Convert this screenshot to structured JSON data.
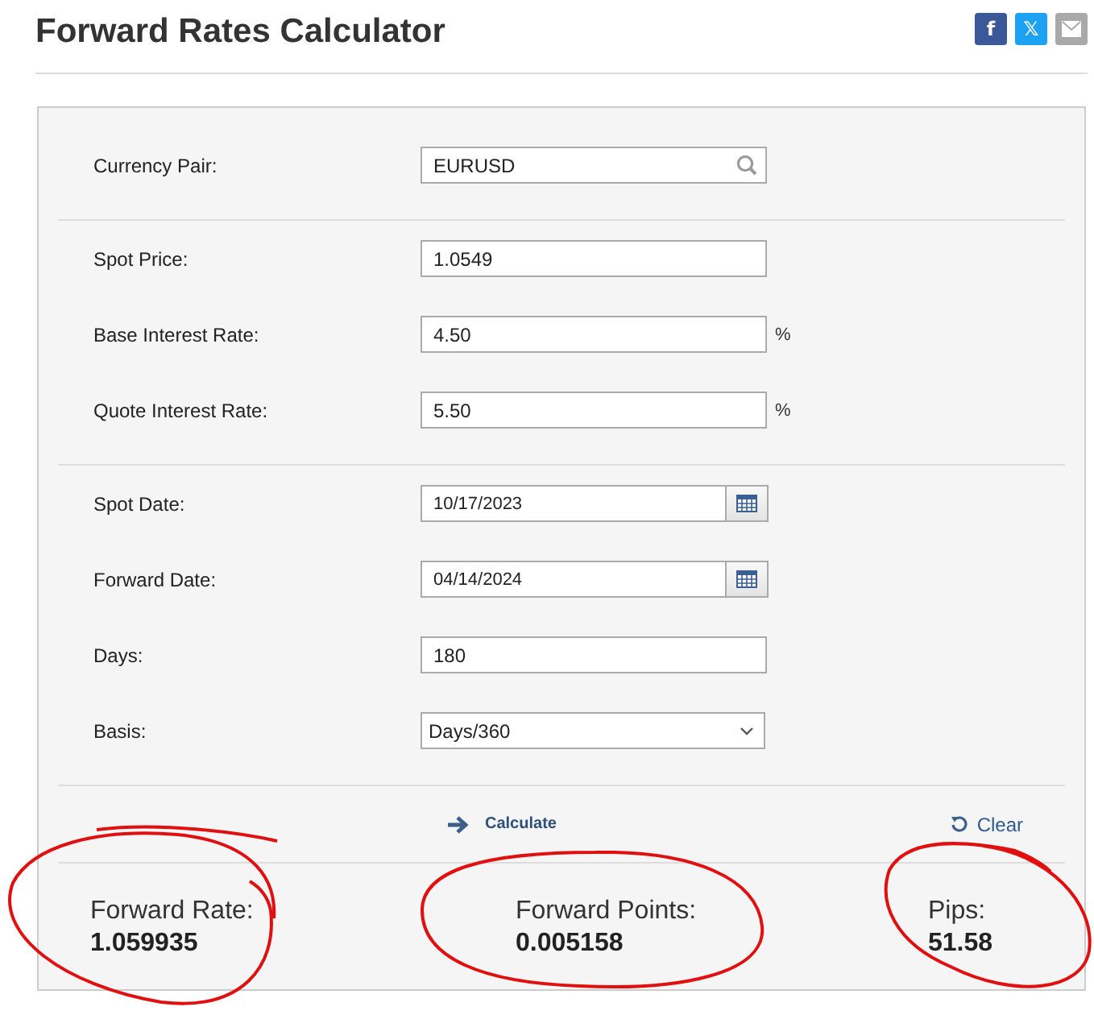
{
  "title": "Forward Rates Calculator",
  "share_buttons": [
    {
      "kind": "glyph",
      "label": "f",
      "color": "#3b5998"
    },
    {
      "kind": "glyph",
      "label": "𝕏",
      "color": "#1da1f2"
    },
    {
      "kind": "mail",
      "color": "#a9a9a9"
    }
  ],
  "sections": [
    {
      "fields": [
        {
          "label": "Currency Pair:",
          "kind": "search",
          "value": "EURUSD"
        }
      ]
    },
    {
      "fields": [
        {
          "label": "Spot Price:",
          "kind": "text",
          "value": "1.0549"
        },
        {
          "label": "Base Interest Rate:",
          "kind": "percent",
          "value": "4.50",
          "unit": "%"
        },
        {
          "label": "Quote Interest Rate:",
          "kind": "percent",
          "value": "5.50",
          "unit": "%"
        }
      ]
    },
    {
      "fields": [
        {
          "label": "Spot Date:",
          "kind": "date",
          "value": "10/17/2023"
        },
        {
          "label": "Forward Date:",
          "kind": "date",
          "value": "04/14/2024"
        },
        {
          "label": "Days:",
          "kind": "text",
          "value": "180"
        },
        {
          "label": "Basis:",
          "kind": "select",
          "value": "Days/360"
        }
      ]
    }
  ],
  "actions": {
    "calculate": "Calculate",
    "clear": "Clear"
  },
  "results": [
    {
      "label": "Forward Rate:",
      "value": "1.059935"
    },
    {
      "label": "Forward Points:",
      "value": "0.005158"
    },
    {
      "label": "Pips:",
      "value": "51.58"
    }
  ]
}
